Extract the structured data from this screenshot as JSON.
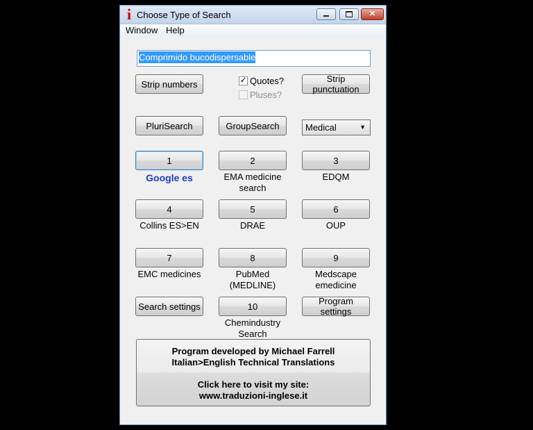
{
  "window": {
    "title": "Choose Type of Search"
  },
  "menu": {
    "window": "Window",
    "help": "Help"
  },
  "search": {
    "value": "Comprimido bucodispersable"
  },
  "options": {
    "strip_numbers": "Strip numbers",
    "quotes": "Quotes?",
    "pluses": "Pluses?",
    "strip_punct_line1": "Strip",
    "strip_punct_line2": "punctuation",
    "plurisearch": "PluriSearch",
    "groupsearch": "GroupSearch",
    "category_selected": "Medical"
  },
  "buttons": [
    {
      "key": "1",
      "label": "Google es"
    },
    {
      "key": "2",
      "label_line1": "EMA medicine",
      "label_line2": "search"
    },
    {
      "key": "3",
      "label": "EDQM"
    },
    {
      "key": "4",
      "label": "Collins ES>EN"
    },
    {
      "key": "5",
      "label": "DRAE"
    },
    {
      "key": "6",
      "label": "OUP"
    },
    {
      "key": "7",
      "label": "EMC medicines"
    },
    {
      "key": "8",
      "label_line1": "PubMed",
      "label_line2": "(MEDLINE)"
    },
    {
      "key": "9",
      "label_line1": "Medscape",
      "label_line2": "emedicine"
    },
    {
      "key": "10",
      "label_line1": "Chemindustry",
      "label_line2": "Search"
    }
  ],
  "settings": {
    "search_settings": "Search settings",
    "program_settings_line1": "Program",
    "program_settings_line2": "settings"
  },
  "info": {
    "line1": "Program developed by Michael Farrell",
    "line2": "Italian>English Technical Translations",
    "line3": "Click here to visit my site:",
    "line4": "www.traduzioni-inglese.it"
  },
  "colors": {
    "google_label": "#1a3cc8",
    "selection": "#3399ff",
    "app_icon": "#d40000"
  }
}
